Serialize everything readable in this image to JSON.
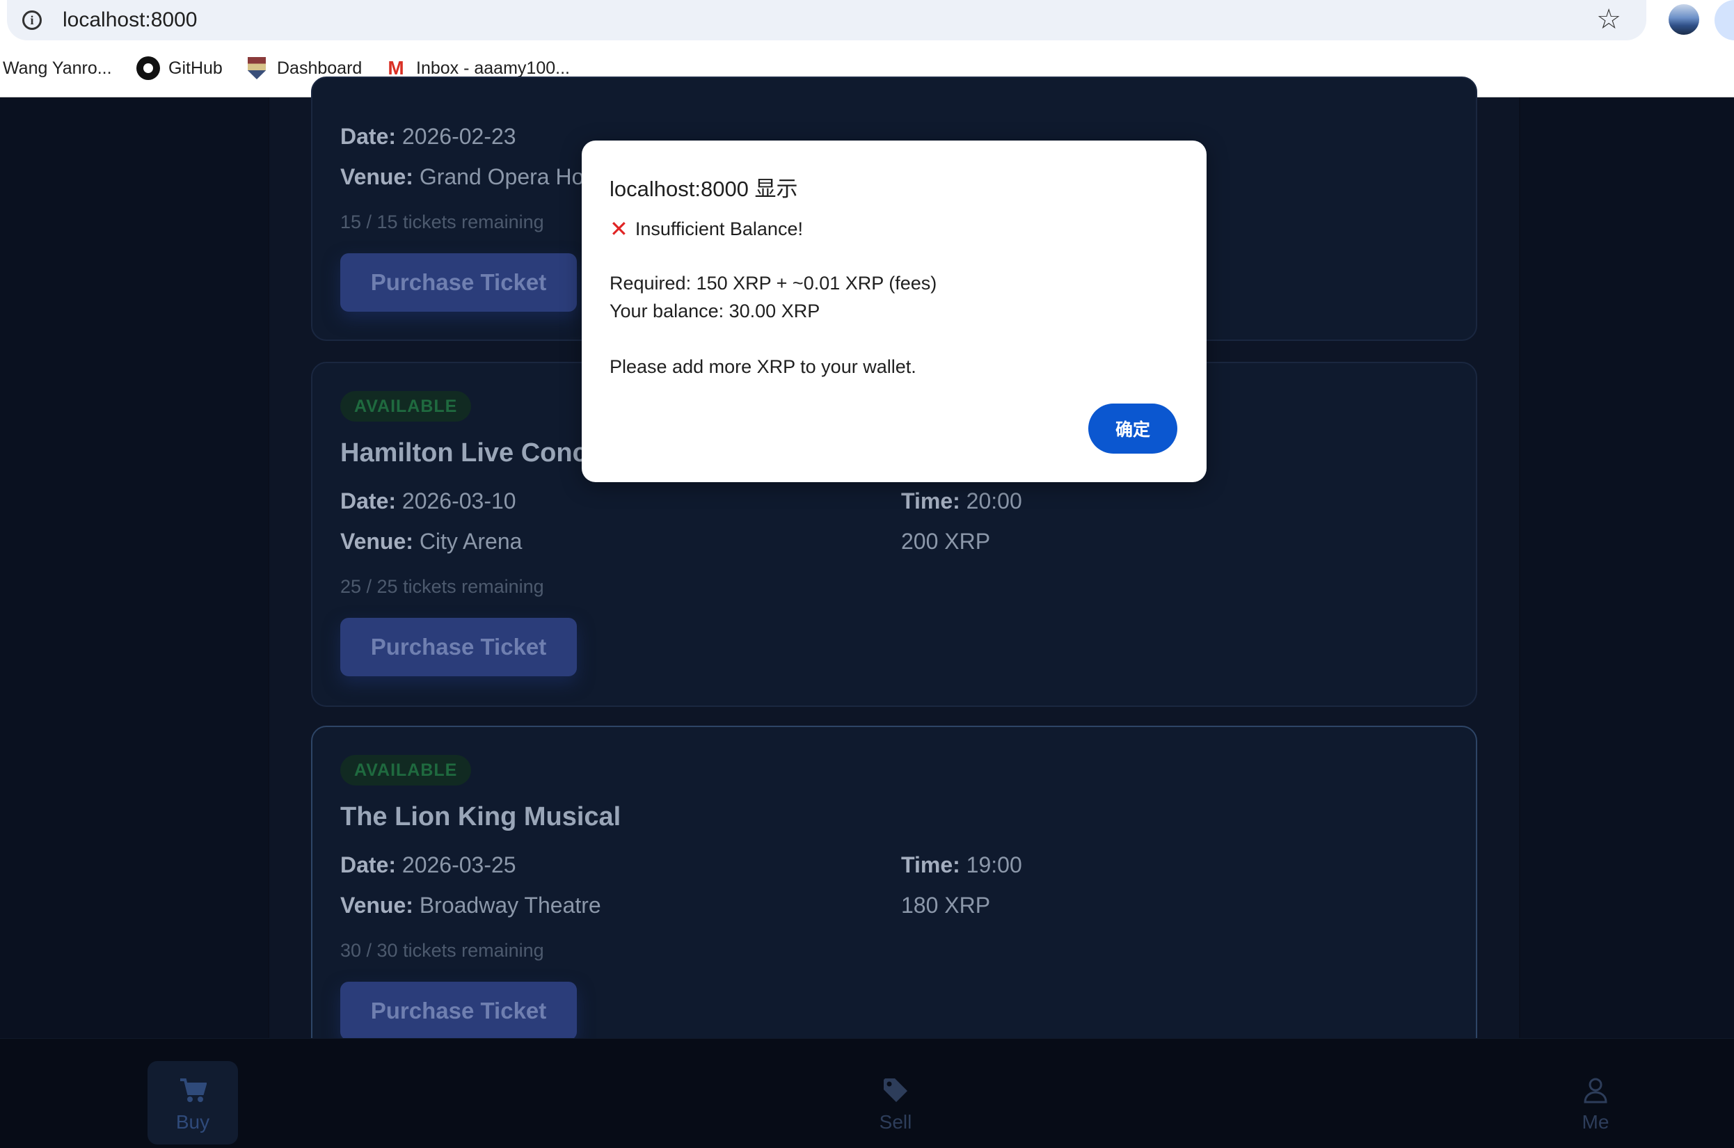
{
  "browser": {
    "url": "localhost:8000",
    "bookmarks": [
      {
        "label": "Wang Yanro..."
      },
      {
        "label": "GitHub"
      },
      {
        "label": "Dashboard"
      },
      {
        "label": "Inbox - aaamy100..."
      }
    ]
  },
  "events": [
    {
      "status": "",
      "title": "",
      "date_label": "Date:",
      "date": "2026-02-23",
      "venue_label": "Venue:",
      "venue": "Grand Opera Ho",
      "time_label": "",
      "time": "",
      "price": "",
      "remaining": "15 / 15 tickets remaining",
      "button": "Purchase Ticket"
    },
    {
      "status": "AVAILABLE",
      "title": "Hamilton Live Concert",
      "date_label": "Date:",
      "date": "2026-03-10",
      "venue_label": "Venue:",
      "venue": "City Arena",
      "time_label": "Time:",
      "time": "20:00",
      "price": "200 XRP",
      "remaining": "25 / 25 tickets remaining",
      "button": "Purchase Ticket"
    },
    {
      "status": "AVAILABLE",
      "title": "The Lion King Musical",
      "date_label": "Date:",
      "date": "2026-03-25",
      "venue_label": "Venue:",
      "venue": "Broadway Theatre",
      "time_label": "Time:",
      "time": "19:00",
      "price": "180 XRP",
      "remaining": "30 / 30 tickets remaining",
      "button": "Purchase Ticket"
    }
  ],
  "nav": {
    "buy": "Buy",
    "sell": "Sell",
    "me": "Me"
  },
  "dialog": {
    "title": "localhost:8000 显示",
    "heading": "Insufficient Balance!",
    "required": "Required: 150 XRP + ~0.01 XRP (fees)",
    "balance": "Your balance: 30.00 XRP",
    "advice": "Please add more XRP to your wallet.",
    "ok": "确定"
  },
  "colors": {
    "dialog_button": "#0b57d0",
    "error_icon": "#e02424",
    "badge_text": "#1f6a3f"
  }
}
